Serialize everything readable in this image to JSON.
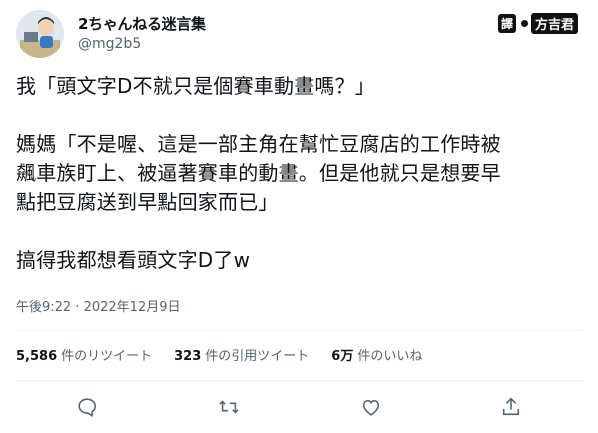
{
  "user": {
    "display_name": "2ちゃんねる迷言集",
    "handle": "@mg2b5"
  },
  "stamp": {
    "seal": "譯",
    "name": "方吉君"
  },
  "tweet": {
    "line1": "我「頭文字D不就只是個賽車動畫嗎？」",
    "line2": "媽媽「不是喔、這是一部主角在幫忙豆腐店的工作時被",
    "line3": "飆車族盯上、被逼著賽車的動畫。但是他就只是想要早",
    "line4": "點把豆腐送到早點回家而已」",
    "line5": "搞得我都想看頭文字D了w"
  },
  "timestamp": "午後9:22 · 2022年12月9日",
  "stats": {
    "retweets_count": "5,586",
    "retweets_label": "件のリツイート",
    "quotes_count": "323",
    "quotes_label": "件の引用ツイート",
    "likes_count": "6万",
    "likes_label": "件のいいね"
  },
  "icons": {
    "reply": "reply-icon",
    "retweet": "retweet-icon",
    "like": "like-icon",
    "share": "share-icon"
  },
  "colors": {
    "secondary_text": "#536471",
    "divider": "#eff3f4"
  }
}
